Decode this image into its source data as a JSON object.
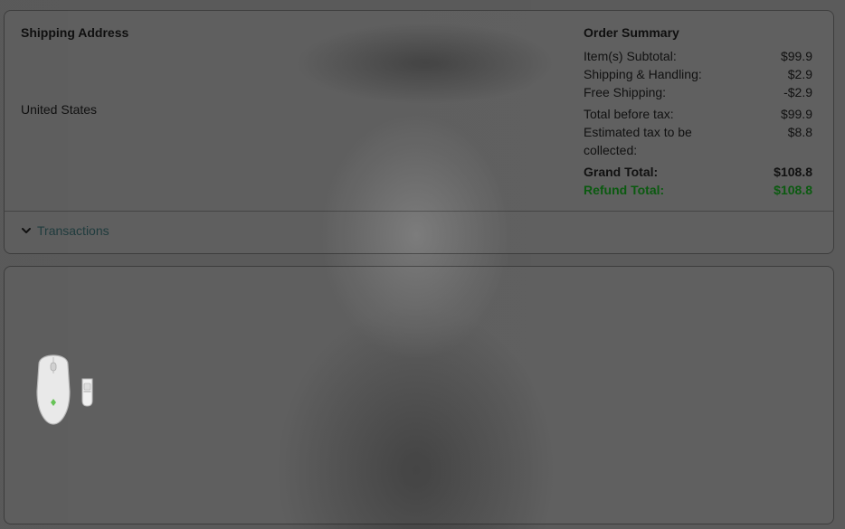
{
  "shipping": {
    "title": "Shipping Address",
    "country": "United States"
  },
  "summary": {
    "title": "Order Summary",
    "rows": [
      {
        "label": "Item(s) Subtotal:",
        "value": "$99.9"
      },
      {
        "label": "Shipping & Handling:",
        "value": "$2.9"
      },
      {
        "label": "Free Shipping:",
        "value": "-$2.9"
      },
      {
        "label": "Total before tax:",
        "value": "$99.9"
      },
      {
        "label": "Estimated tax to be collected:",
        "value": "$8.8"
      },
      {
        "label": "Grand Total:",
        "value": "$108.8"
      },
      {
        "label": "Refund Total:",
        "value": "$108.8"
      }
    ]
  },
  "transactions": {
    "label": "Transactions",
    "icon": "chevron-down-icon"
  },
  "product": {
    "icon": "product-thumbnail-icon"
  },
  "colors": {
    "refund_text": "#0b5a10",
    "border": "#141414"
  }
}
